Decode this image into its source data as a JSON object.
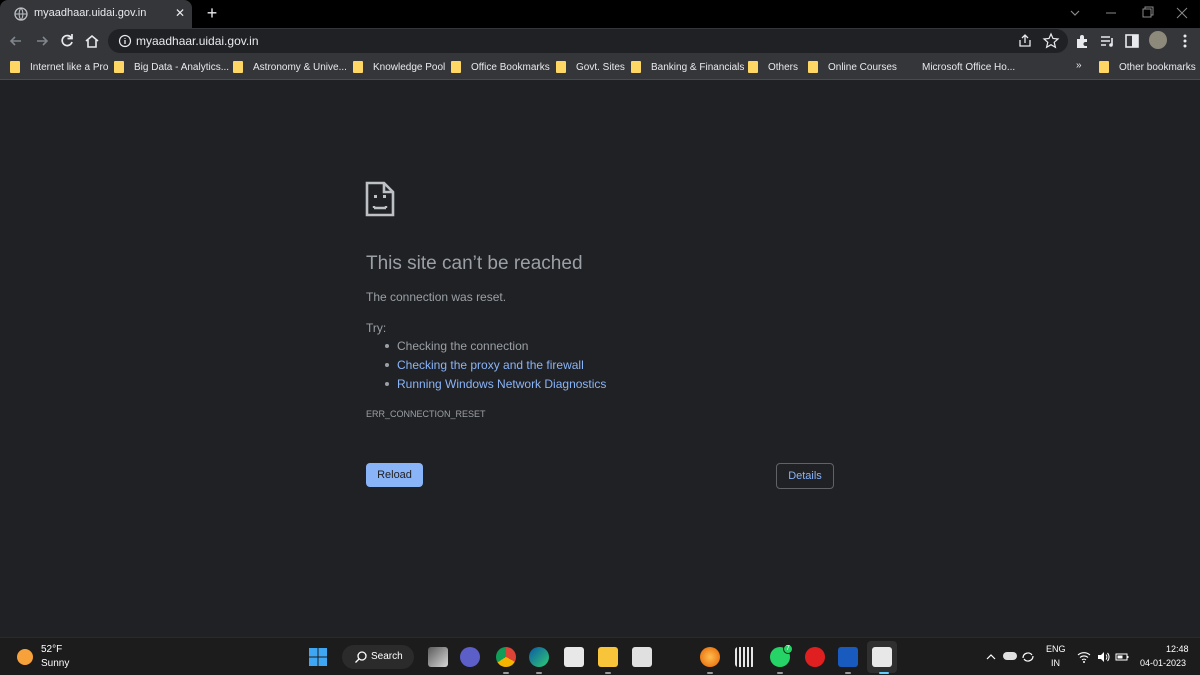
{
  "browser": {
    "tab": {
      "title": "myaadhaar.uidai.gov.in",
      "close": "✕"
    },
    "new_tab": "+",
    "address": "myaadhaar.uidai.gov.in",
    "bookmarks": [
      "Internet like a Pro",
      "Big Data - Analytics...",
      "Astronomy & Unive...",
      "Knowledge Pool",
      "Office Bookmarks",
      "Govt. Sites",
      "Banking & Financials",
      "Others",
      "Online Courses"
    ],
    "bookmark_plain": "Microsoft Office Ho...",
    "bookmarks_more": "»",
    "other_bookmarks": "Other bookmarks",
    "colors": {
      "folder": "#fdd663",
      "link": "#8ab4f8",
      "text": "#9aa0a6",
      "bg": "#202124"
    }
  },
  "error_page": {
    "icon": "sad-page-icon",
    "title": "This site can’t be reached",
    "message": "The connection was reset.",
    "try_label": "Try:",
    "suggestions": [
      "Checking the connection",
      "Checking the proxy and the firewall",
      "Running Windows Network Diagnostics"
    ],
    "error_code": "ERR_CONNECTION_RESET",
    "reload_label": "Reload",
    "details_label": "Details"
  },
  "taskbar": {
    "weather_temp": "52°F",
    "weather_desc": "Sunny",
    "search_label": "Search",
    "whatsapp_badge": "7",
    "lang_primary": "ENG",
    "lang_secondary": "IN",
    "time": "12:48",
    "date": "04-01-2023"
  }
}
